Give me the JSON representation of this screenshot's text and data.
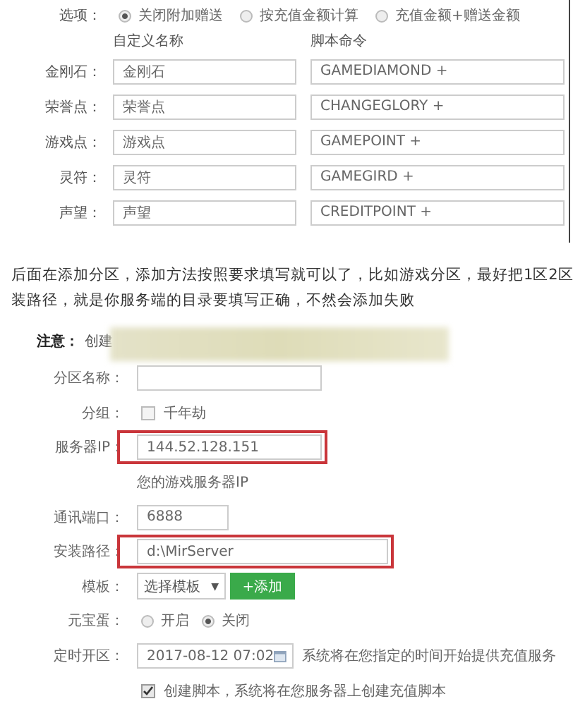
{
  "options": {
    "label": "选项：",
    "choices": [
      {
        "label": "关闭附加赠送",
        "selected": true
      },
      {
        "label": "按充值金额计算",
        "selected": false
      },
      {
        "label": "充值金额+赠送金额",
        "selected": false
      }
    ]
  },
  "columns": [
    "自定义名称",
    "脚本命令"
  ],
  "currencies": [
    {
      "label": "金刚石：",
      "name": "金刚石",
      "command": "GAMEDIAMOND +"
    },
    {
      "label": "荣誉点：",
      "name": "荣誉点",
      "command": "CHANGEGLORY +"
    },
    {
      "label": "游戏点：",
      "name": "游戏点",
      "command": "GAMEPOINT +"
    },
    {
      "label": "灵符：",
      "name": "灵符",
      "command": "GAMEGIRD +"
    },
    {
      "label": "声望：",
      "name": "声望",
      "command": "CREDITPOINT +"
    }
  ],
  "paragraph": [
    "后面在添加分区，添加方法按照要求填写就可以了，比如游戏分区，最好把1区2区",
    "装路径，就是你服务端的目录要填写正确，不然会添加失败"
  ],
  "notice": {
    "label": "注意：",
    "text": "创建"
  },
  "form": [
    {
      "kind": "text",
      "label": "分区名称：",
      "highlighted": false
    },
    {
      "kind": "checkbox",
      "label": "分组：",
      "option": "千年劫",
      "checked": false
    },
    {
      "kind": "text",
      "label": "服务器IP：",
      "value": "144.52.128.151",
      "highlighted": true
    },
    {
      "kind": "hint",
      "text": "您的游戏服务器IP"
    },
    {
      "kind": "short_text",
      "label": "通讯端口：",
      "value": "6888",
      "highlighted": false
    },
    {
      "kind": "wide_text",
      "label": "安装路径：",
      "value": "d:\\MirServer",
      "highlighted": true
    },
    {
      "kind": "select",
      "label": "模板：",
      "value": "选择模板",
      "arrow": "▼",
      "button": "+添加"
    },
    {
      "kind": "radio",
      "label": "元宝蛋：",
      "choices": [
        {
          "label": "开启",
          "selected": false
        },
        {
          "label": "关闭",
          "selected": true
        }
      ]
    },
    {
      "kind": "datetime",
      "label": "定时开区：",
      "value": "2017-08-12 07:02",
      "note": "系统将在您指定的时间开始提供充值服务"
    },
    {
      "kind": "check",
      "text": "创建脚本，系统将在您服务器上创建充值脚本",
      "checked": true
    }
  ]
}
